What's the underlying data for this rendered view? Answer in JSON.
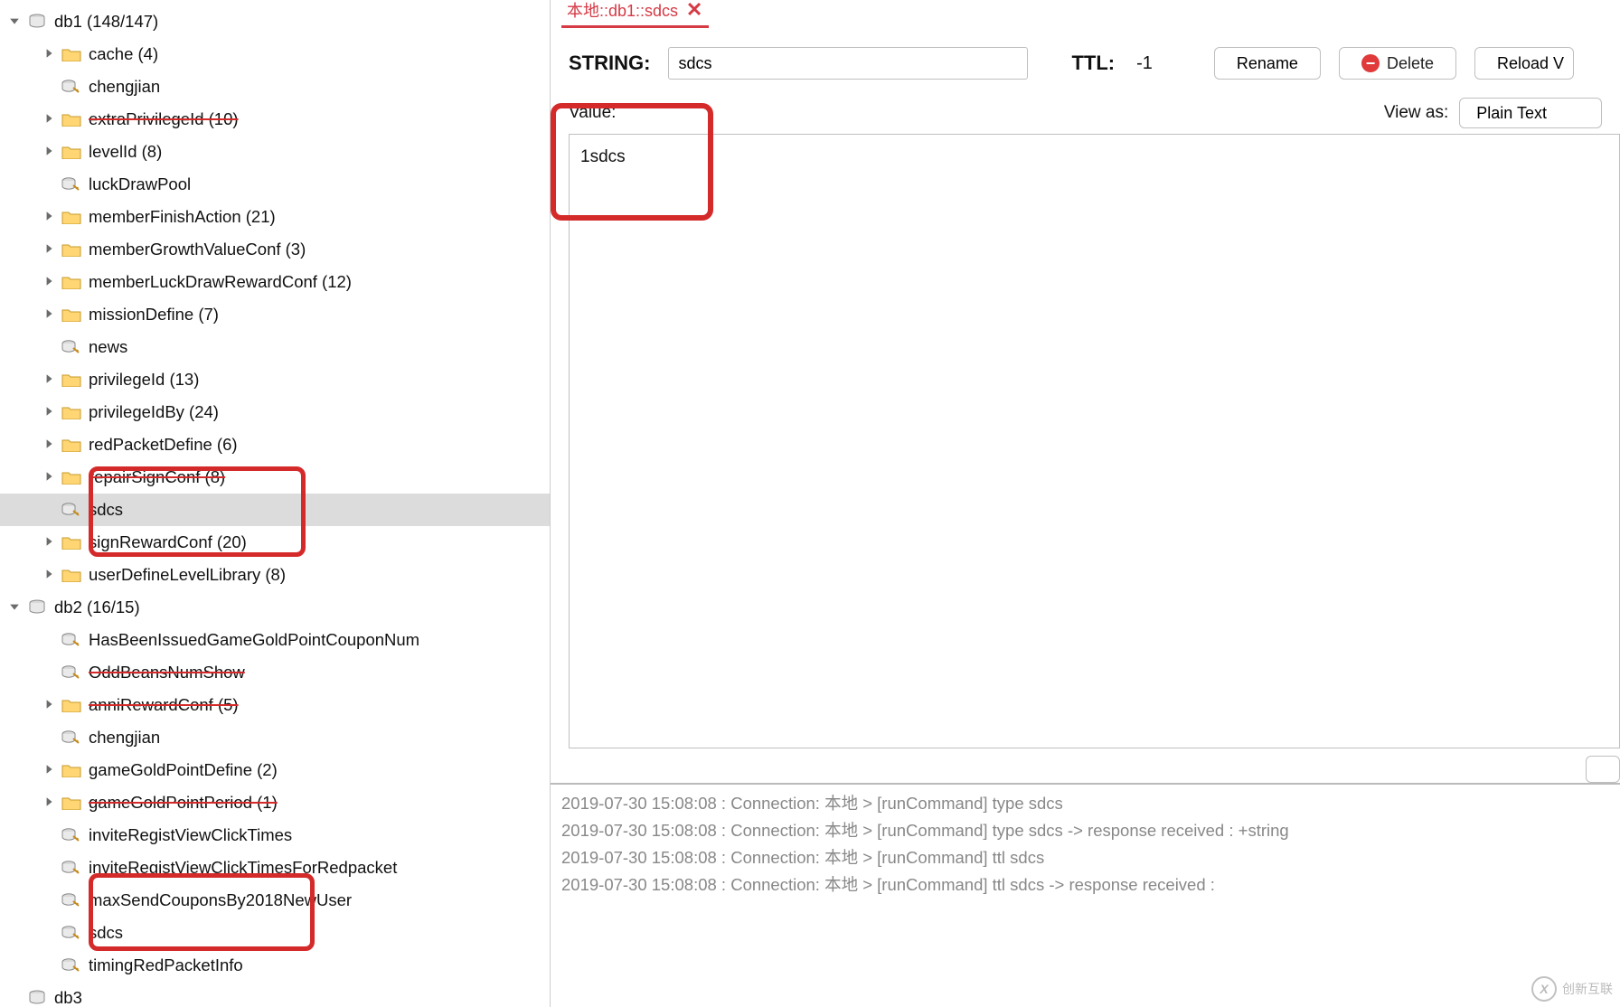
{
  "tree": {
    "db1": {
      "label": "db1 (148/147)"
    },
    "db1_items": [
      {
        "kind": "folder",
        "name": "cache",
        "label": "cache (4)",
        "arrow": true
      },
      {
        "kind": "key",
        "name": "chengjian",
        "label": "chengjian"
      },
      {
        "kind": "folder",
        "name": "extraPrivilegeId",
        "label": "extraPrivilegeId (10)",
        "arrow": true,
        "strike": true
      },
      {
        "kind": "folder",
        "name": "levelId",
        "label": "levelId (8)",
        "arrow": true
      },
      {
        "kind": "key",
        "name": "luckDrawPool",
        "label": "luckDrawPool"
      },
      {
        "kind": "folder",
        "name": "memberFinishAction",
        "label": "memberFinishAction (21)",
        "arrow": true
      },
      {
        "kind": "folder",
        "name": "memberGrowthValueConf",
        "label": "memberGrowthValueConf (3)",
        "arrow": true
      },
      {
        "kind": "folder",
        "name": "memberLuckDrawRewardConf",
        "label": "memberLuckDrawRewardConf (12)",
        "arrow": true
      },
      {
        "kind": "folder",
        "name": "missionDefine",
        "label": "missionDefine (7)",
        "arrow": true
      },
      {
        "kind": "key",
        "name": "news",
        "label": "news"
      },
      {
        "kind": "folder",
        "name": "privilegeId",
        "label": "privilegeId (13)",
        "arrow": true
      },
      {
        "kind": "folder",
        "name": "privilegeIdBy",
        "label": "privilegeIdBy (24)",
        "arrow": true
      },
      {
        "kind": "folder",
        "name": "redPacketDefine",
        "label": "redPacketDefine (6)",
        "arrow": true
      },
      {
        "kind": "folder",
        "name": "repairSignConf",
        "label": "repairSignConf (8)",
        "arrow": true,
        "strike": true
      },
      {
        "kind": "key",
        "name": "sdcs",
        "label": "sdcs",
        "selected": true
      },
      {
        "kind": "folder",
        "name": "signRewardConf",
        "label": "signRewardConf (20)",
        "arrow": true
      },
      {
        "kind": "folder",
        "name": "userDefineLevelLibrary",
        "label": "userDefineLevelLibrary (8)",
        "arrow": true
      }
    ],
    "db2": {
      "label": "db2 (16/15)"
    },
    "db2_items": [
      {
        "kind": "key",
        "name": "HasBeenIssuedGameGoldPointCouponNum",
        "label": "HasBeenIssuedGameGoldPointCouponNum"
      },
      {
        "kind": "key",
        "name": "OddBeansNumShow",
        "label": "OddBeansNumShow",
        "strike": true
      },
      {
        "kind": "folder",
        "name": "anniRewardConf",
        "label": "anniRewardConf (5)",
        "arrow": true,
        "strike": true
      },
      {
        "kind": "key",
        "name": "chengjian",
        "label": "chengjian"
      },
      {
        "kind": "folder",
        "name": "gameGoldPointDefine",
        "label": "gameGoldPointDefine (2)",
        "arrow": true
      },
      {
        "kind": "folder",
        "name": "gameGoldPointPeriod",
        "label": "gameGoldPointPeriod (1)",
        "arrow": true,
        "strike": true
      },
      {
        "kind": "key",
        "name": "inviteRegistViewClickTimes",
        "label": "inviteRegistViewClickTimes"
      },
      {
        "kind": "key",
        "name": "inviteRegistViewClickTimesForRedpacket",
        "label": "inviteRegistViewClickTimesForRedpacket"
      },
      {
        "kind": "key",
        "name": "maxSendCouponsBy2018NewUser",
        "label": "maxSendCouponsBy2018NewUser"
      },
      {
        "kind": "key",
        "name": "sdcs",
        "label": "sdcs"
      },
      {
        "kind": "key",
        "name": "timingRedPacketInfo",
        "label": "timingRedPacketInfo"
      }
    ],
    "db3": {
      "label": "db3"
    }
  },
  "tab": {
    "title": "本地::db1::sdcs"
  },
  "detail": {
    "type_label": "STRING:",
    "key_value": "sdcs",
    "ttl_label": "TTL:",
    "ttl_value": "-1",
    "rename": "Rename",
    "delete": "Delete",
    "reload": "Reload V",
    "value_label": "Value:",
    "view_as_label": "View as:",
    "view_as_value": "Plain Text",
    "value_text": "1sdcs"
  },
  "log": [
    "2019-07-30 15:08:08 : Connection: 本地 > [runCommand] type sdcs",
    "2019-07-30 15:08:08 : Connection: 本地 > [runCommand] type sdcs -> response received : +string",
    "2019-07-30 15:08:08 : Connection: 本地 > [runCommand] ttl sdcs",
    "2019-07-30 15:08:08 : Connection: 本地 > [runCommand] ttl sdcs -> response received :"
  ],
  "watermark": "创新互联"
}
